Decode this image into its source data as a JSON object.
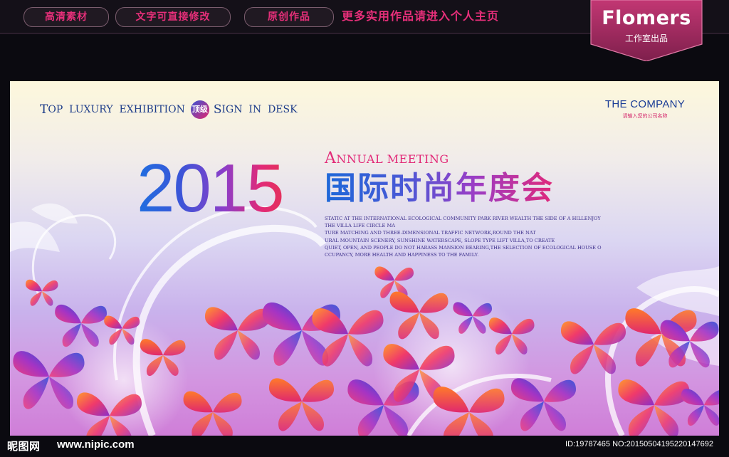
{
  "topbar": {
    "pills": [
      "高清素材",
      "文字可直接修改",
      "原创作品"
    ],
    "promo": "更多实用作品请进入个人主页",
    "brand_name": "Flomers",
    "brand_sub": "工作室出品"
  },
  "banner": {
    "tagline": {
      "w1_cap": "T",
      "w1_rest": "OP",
      "w2": "LUXURY",
      "w3": "EXHIBITION",
      "badge": "顶级",
      "w4_cap": "S",
      "w4_rest": "IGN",
      "w5": "IN",
      "w6": "DESK"
    },
    "company": "THE COMPANY",
    "company_sub": "请输入您的公司名称",
    "year": "2015",
    "annual_cap": "A",
    "annual_rest": "NNUAL MEETING",
    "title_cn": "国际时尚年度会",
    "desc_lines": [
      "STATIC AT THE INTERNATIONAL ECOLOGICAL COMMUNITY PARK RIVER WEALTH THE SIDE OF A HILLENJOY",
      "THE VILLA LIFE CIRCLE MA",
      "TURE MATCHING AND THREE-DIMENSIONAL TRAFFIC NETWORK,ROUND THE NAT",
      "URAL MOUNTAIN SCENERY, SUNSHINE WATERSCAPE, SLOPE TYPE LIFT VILLA,TO CREATE",
      "QUIET, OPEN, AND PEOPLE DO NOT HARASS MANSION BEARING,THE SELECTION OF ECOLOGICAL HOUSE O",
      "CCUPANCY, MORE HEALTH AND HAPPINESS TO THE FAMILY."
    ]
  },
  "footer": {
    "logo": "昵图网",
    "url": "www.nipic.com",
    "id_text": "ID:19787465 NO:20150504195220147692"
  },
  "colors": {
    "accent_pink": "#e72f7a",
    "brand_magenta": "#a3275f",
    "title_blue": "#1d68d8"
  }
}
